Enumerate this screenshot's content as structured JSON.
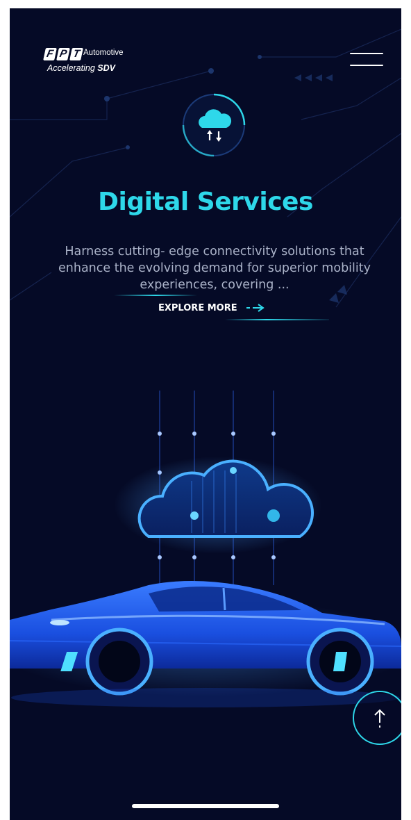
{
  "header": {
    "logo_letters": [
      "F",
      "P",
      "T"
    ],
    "logo_product": "Automotive",
    "logo_tagline_prefix": "Accelerating",
    "logo_tagline_bold": "SDV",
    "menu_icon": "hamburger-menu-icon"
  },
  "hero": {
    "service_icon": "cloud-sync-icon",
    "title": "Digital Services",
    "description": "Harness cutting- edge connectivity solutions that enhance the evolving demand for superior mobility experiences, covering ...",
    "cta_label": "EXPLORE MORE",
    "cta_icon": "dashed-arrow-right-icon"
  },
  "illustration": {
    "subject": "cloud-connected-car-illustration"
  },
  "scroll_top": {
    "icon": "arrow-up-icon"
  },
  "colors": {
    "background": "#050a26",
    "accent": "#2ed8ea",
    "text_muted": "#aab2c8",
    "car_blue": "#1f6bff"
  }
}
